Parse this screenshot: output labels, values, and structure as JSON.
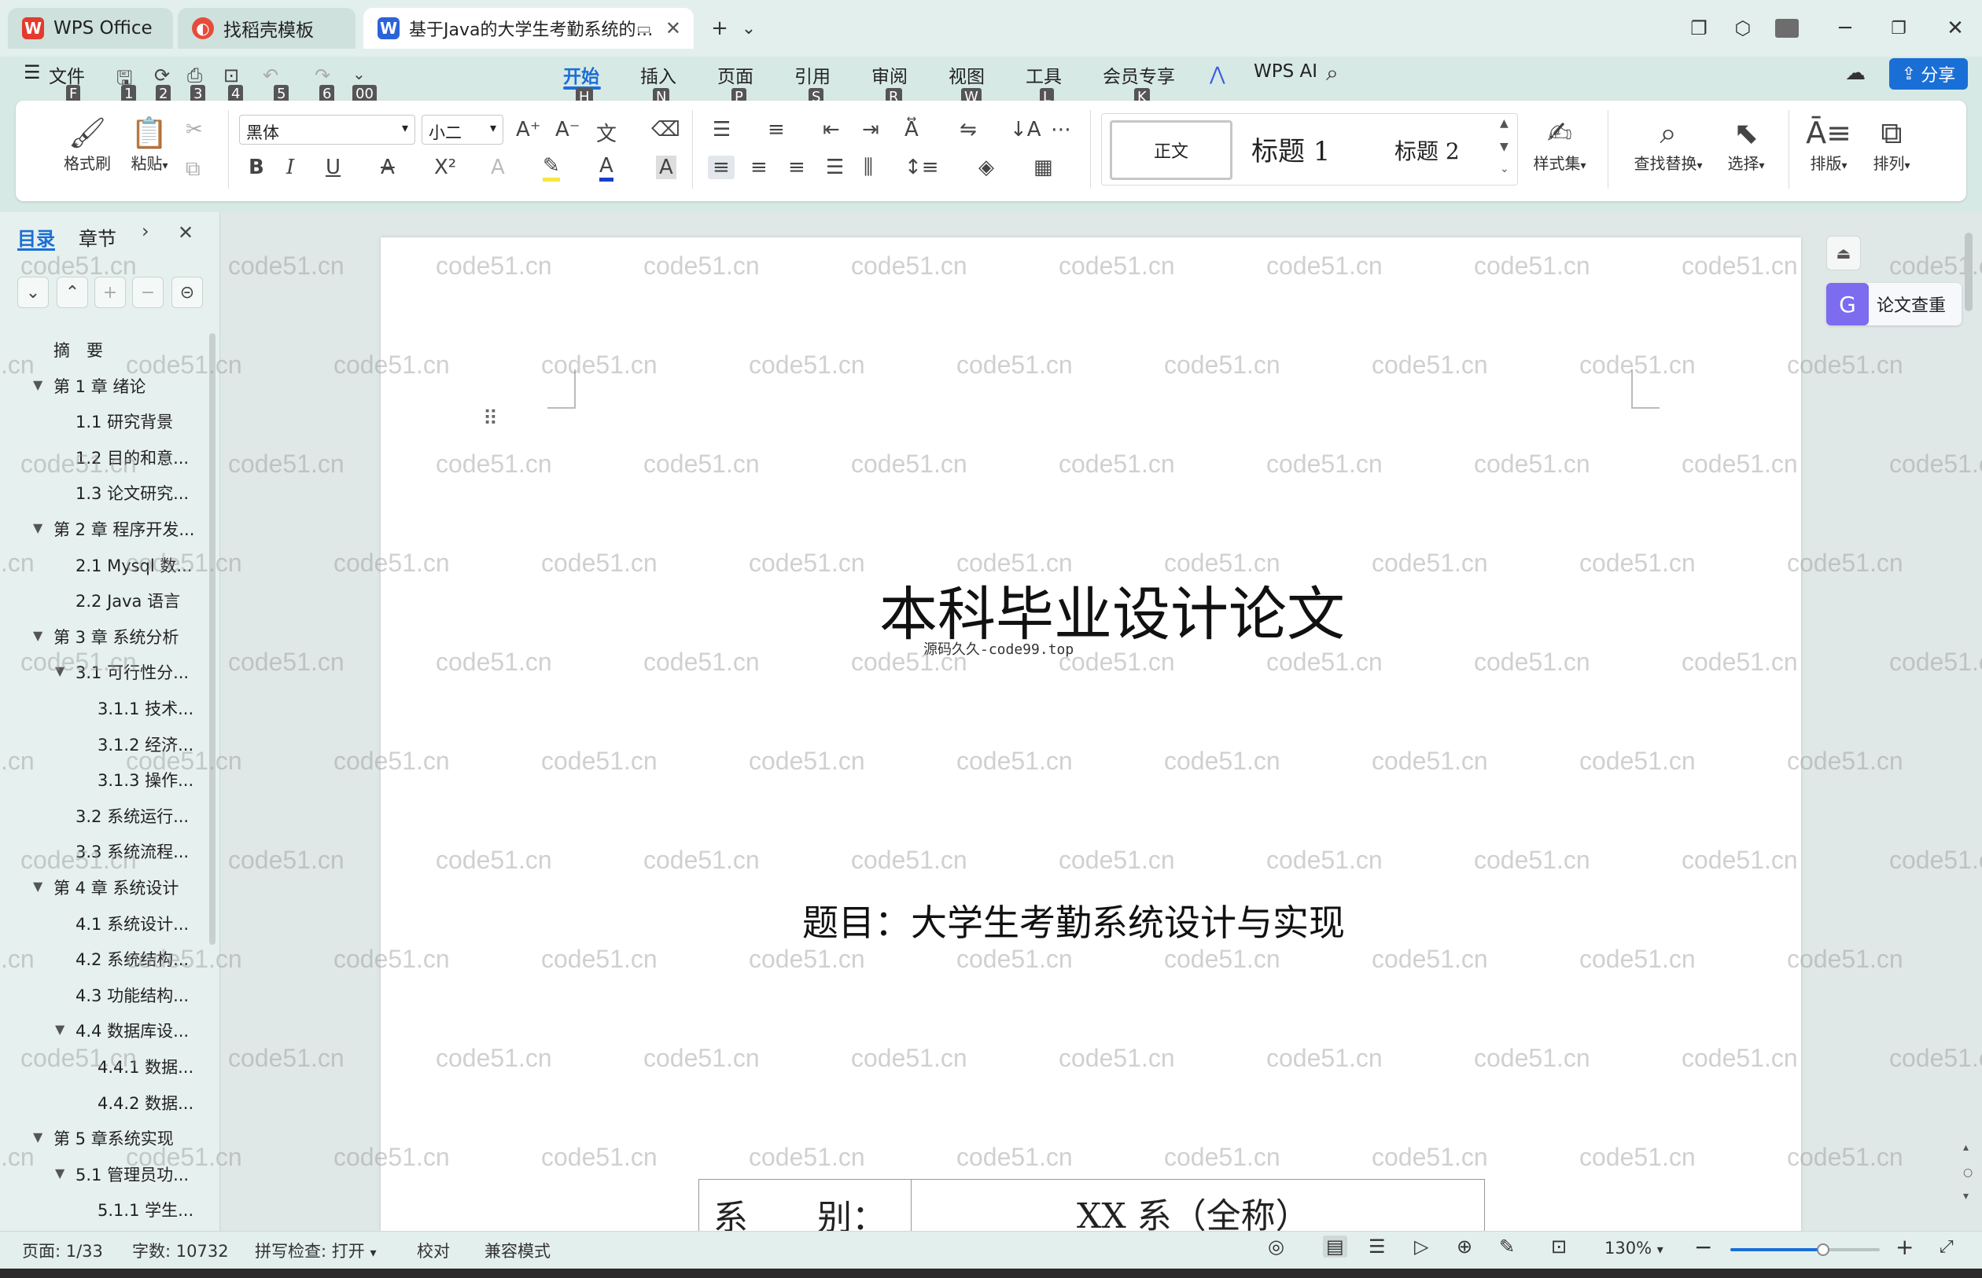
{
  "titlebar": {
    "tabs": [
      {
        "label": "WPS Office",
        "icon": "wps-logo-icon"
      },
      {
        "label": "找稻壳模板",
        "icon": "docer-icon"
      },
      {
        "label": "基于Java的大学生考勤系统的…",
        "icon": "word-doc-icon"
      }
    ],
    "new_tab_symbol": "+",
    "dropdown_symbol": "⌄"
  },
  "menu": {
    "file": "文件",
    "tabs": [
      "开始",
      "插入",
      "页面",
      "引用",
      "审阅",
      "视图",
      "工具",
      "会员专享"
    ],
    "active_tab": "开始",
    "wps_ai": "WPS AI",
    "share": "分享",
    "keytips": {
      "file": "F",
      "qa": [
        "1",
        "2",
        "3",
        "4",
        "5",
        "6",
        "00"
      ],
      "tabs": [
        "H",
        "N",
        "P",
        "S",
        "R",
        "W",
        "L",
        "K"
      ]
    }
  },
  "ribbon": {
    "format_painter": "格式刷",
    "paste": "粘贴",
    "font_name": "黑体",
    "font_size": "小二",
    "styles": {
      "normal": "正文",
      "heading1": "标题 1",
      "heading2": "标题 2"
    },
    "style_set": "样式集",
    "find_replace": "查找替换",
    "select": "选择",
    "layout": "排版",
    "arrange": "排列"
  },
  "nav": {
    "tab_toc": "目录",
    "tab_section": "章节",
    "items": [
      "摘　要",
      "第 1 章  绪论",
      "1.1  研究背景",
      "1.2 目的和意...",
      "1.3  论文研究...",
      "第 2 章  程序开发...",
      "2.1 Mysql 数...",
      "2.2 Java 语言",
      "第 3 章  系统分析",
      "3.1 可行性分...",
      "3.1.1  技术...",
      "3.1.2  经济...",
      "3.1.3  操作...",
      "3.2 系统运行...",
      "3.3 系统流程...",
      "第 4 章  系统设计",
      "4.1  系统设计...",
      "4.2  系统结构...",
      "4.3 功能结构...",
      "4.4 数据库设...",
      "4.4.1  数据...",
      "4.4.2  数据...",
      "第 5 章系统实现",
      "5.1 管理员功...",
      "5.1.1  学生..."
    ]
  },
  "document": {
    "main_title": "本科毕业设计论文",
    "source_note": "源码久久-code99.top",
    "subject": "题目：大学生考勤系统设计与实现",
    "table_label": "系　　别：",
    "table_value": "XX 系（全称）",
    "watermark": "code51.cn"
  },
  "side_panel": {
    "plagiarism_check": "论文查重"
  },
  "status": {
    "page": "页面: 1/33",
    "words": "字数: 10732",
    "spellcheck": "拼写检查: 打开",
    "proofread": "校对",
    "compat": "兼容模式",
    "zoom": "130%",
    "zoom_level": 0.62
  },
  "colors": {
    "accent": "#1a6fd6",
    "active_tab_text": "#1a6fd6",
    "wps_red": "#e33b2e",
    "word_blue": "#2b63d9"
  }
}
